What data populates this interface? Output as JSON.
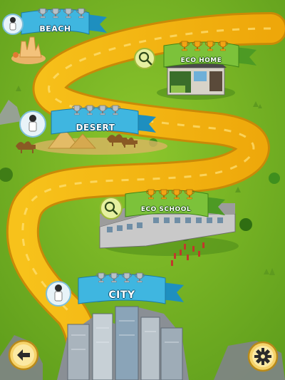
{
  "levels": {
    "beach": {
      "label": "BEACH",
      "trophies": [
        "silver",
        "silver",
        "silver",
        "silver"
      ],
      "state": "unlocked"
    },
    "eco_home": {
      "label": "ECO HOME",
      "trophies": [
        "gold",
        "gold",
        "gold",
        "gold"
      ],
      "state": "locked"
    },
    "desert": {
      "label": "DESERT",
      "trophies": [
        "silver",
        "silver",
        "silver",
        "silver"
      ],
      "state": "unlocked"
    },
    "eco_school": {
      "label": "ECO SCHOOL",
      "trophies": [
        "gold",
        "gold",
        "gold",
        "gold"
      ],
      "state": "locked"
    },
    "city": {
      "label": "CITY",
      "trophies": [
        "silver",
        "silver",
        "silver",
        "silver"
      ],
      "state": "unlocked"
    }
  },
  "colors": {
    "grass": "#7fb82a",
    "path": "#f5b80e",
    "blue_ribbon": "#3fb6e0",
    "green_ribbon": "#7cc23a",
    "gold": "#f2a414",
    "silver": "#b8c1c7"
  },
  "controls": {
    "back_icon": "arrow-left-icon",
    "settings_icon": "gear-icon"
  }
}
